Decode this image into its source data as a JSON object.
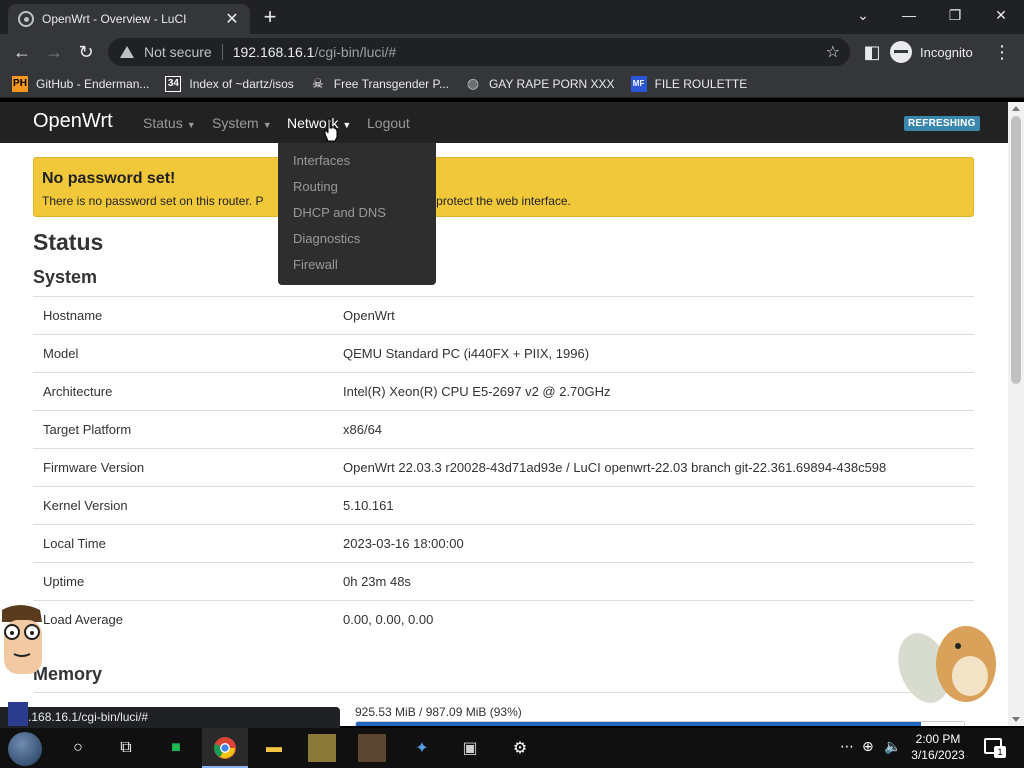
{
  "browser": {
    "tab_title": "OpenWrt - Overview - LuCI",
    "tab_close_glyph": "✕",
    "new_tab_glyph": "+",
    "omnibox": {
      "security": "Not secure",
      "host": "192.168.16.1",
      "path": "/cgi-bin/luci/#"
    },
    "incognito_label": "Incognito",
    "bookmarks": [
      {
        "label": "GitHub - Enderman...",
        "icon": "PH",
        "icon_color": "#f7971d"
      },
      {
        "label": "Index of ~dartz/isos",
        "icon": "34",
        "icon_color": "#ffffff"
      },
      {
        "label": "Free Transgender P...",
        "icon": "skull-icon",
        "icon_color": "#ffffff"
      },
      {
        "label": "GAY RAPE PORN XXX",
        "icon": "globe-icon",
        "icon_color": "#bdc1c6"
      },
      {
        "label": "FILE ROULETTE",
        "icon": "MF",
        "icon_color": "#2b57d6"
      }
    ],
    "status_url": "192.168.16.1/cgi-bin/luci/#"
  },
  "luci": {
    "brand": "OpenWrt",
    "nav": [
      {
        "label": "Status",
        "has_caret": true
      },
      {
        "label": "System",
        "has_caret": true
      },
      {
        "label": "Network",
        "has_caret": true
      },
      {
        "label": "Logout",
        "has_caret": false
      }
    ],
    "refresh_badge": "REFRESHING",
    "network_menu": [
      "Interfaces",
      "Routing",
      "DHCP and DNS",
      "Diagnostics",
      "Firewall"
    ],
    "alert": {
      "title": "No password set!",
      "text_visible_left": "There is no password set on this router. P",
      "text_visible_right": "word to protect the web interface."
    },
    "heading_status": "Status",
    "heading_system": "System",
    "system": [
      {
        "key": "Hostname",
        "value": "OpenWrt"
      },
      {
        "key": "Model",
        "value": "QEMU Standard PC (i440FX + PIIX, 1996)"
      },
      {
        "key": "Architecture",
        "value": "Intel(R) Xeon(R) CPU E5-2697 v2 @ 2.70GHz"
      },
      {
        "key": "Target Platform",
        "value": "x86/64"
      },
      {
        "key": "Firmware Version",
        "value": "OpenWrt 22.03.3 r20028-43d71ad93e / LuCI openwrt-22.03 branch git-22.361.69894-438c598"
      },
      {
        "key": "Kernel Version",
        "value": "5.10.161"
      },
      {
        "key": "Local Time",
        "value": "2023-03-16 18:00:00"
      },
      {
        "key": "Uptime",
        "value": "0h 23m 48s"
      },
      {
        "key": "Load Average",
        "value": "0.00, 0.00, 0.00"
      }
    ],
    "heading_memory": "Memory",
    "memory": {
      "value": "925.53 MiB / 987.09 MiB (93%)",
      "fraction": 0.93
    }
  },
  "taskbar": {
    "time": "2:00 PM",
    "date": "3/16/2023",
    "notifications": "1"
  },
  "colors": {
    "navbar": "#222222",
    "alert": "#f1c83a",
    "badge": "#3a87ad",
    "progress": "#2266c2"
  }
}
